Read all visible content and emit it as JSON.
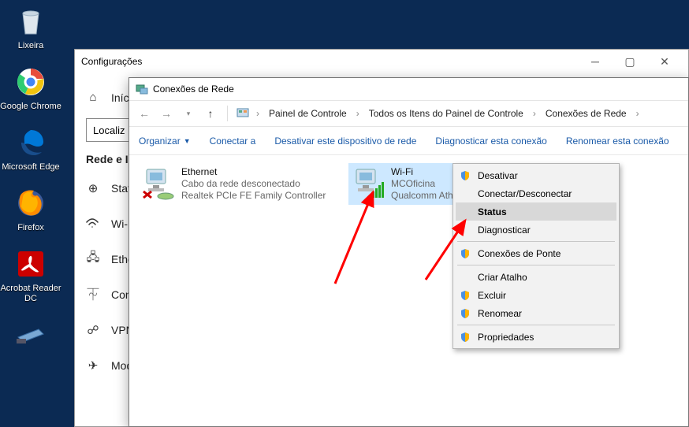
{
  "desktop": {
    "icons": [
      {
        "label": "Lixeira",
        "name": "desktop-icon-recycle-bin"
      },
      {
        "label": "Google Chrome",
        "name": "desktop-icon-chrome"
      },
      {
        "label": "Microsoft Edge",
        "name": "desktop-icon-edge"
      },
      {
        "label": "Firefox",
        "name": "desktop-icon-firefox"
      },
      {
        "label": "Acrobat Reader DC",
        "name": "desktop-icon-acrobat"
      }
    ],
    "scanner_visible": true
  },
  "settings": {
    "title": "Configurações",
    "nav_inicio": "Iníc",
    "search_placeholder": "Localiz",
    "section": "Rede e I",
    "items": [
      "Stat",
      "Wi-",
      "Ethe",
      "Con",
      "VPN",
      "Mod"
    ]
  },
  "explorer": {
    "title": "Conexões de Rede",
    "breadcrumbs": [
      "Painel de Controle",
      "Todos os Itens do Painel de Controle",
      "Conexões de Rede"
    ],
    "commands": {
      "organize": "Organizar",
      "connect": "Conectar a",
      "disable": "Desativar este dispositivo de rede",
      "diagnose": "Diagnosticar esta conexão",
      "rename": "Renomear esta conexão"
    },
    "connections": [
      {
        "name": "Ethernet",
        "status": "Cabo da rede desconectado",
        "adapter": "Realtek PCIe FE Family Controller",
        "selected": false,
        "error": true
      },
      {
        "name": "Wi-Fi",
        "status": "MCOficina",
        "adapter": "Qualcomm Ath",
        "selected": true,
        "error": false
      }
    ]
  },
  "context_menu": {
    "items": [
      {
        "label": "Desativar",
        "shield": true
      },
      {
        "label": "Conectar/Desconectar"
      },
      {
        "label": "Status",
        "highlighted": true
      },
      {
        "label": "Diagnosticar"
      },
      {
        "sep": true
      },
      {
        "label": "Conexões de Ponte",
        "shield": true
      },
      {
        "sep": true
      },
      {
        "label": "Criar Atalho"
      },
      {
        "label": "Excluir",
        "shield": true
      },
      {
        "label": "Renomear",
        "shield": true
      },
      {
        "sep": true
      },
      {
        "label": "Propriedades",
        "shield": true
      }
    ]
  }
}
